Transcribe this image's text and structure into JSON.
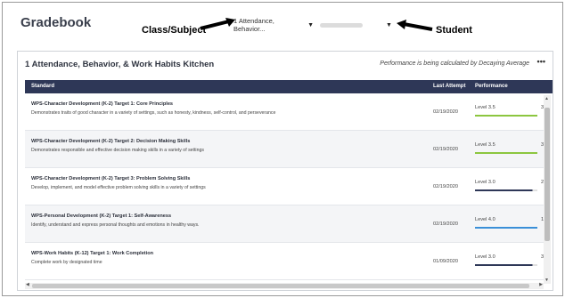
{
  "page": {
    "title": "Gradebook"
  },
  "annotations": {
    "class_subject": "Class/Subject",
    "student": "Student"
  },
  "selectors": {
    "class_value": "1 Attendance, Behavior...",
    "student_value": ""
  },
  "card": {
    "title": "1 Attendance, Behavior, & Work Habits Kitchen",
    "note": "Performance is being calculated by Decaying Average",
    "more": "•••"
  },
  "table": {
    "columns": [
      "Standard",
      "Last Attempt",
      "Performance"
    ],
    "rows": [
      {
        "title": "WPS-Character Development (K-2) Target 1: Core Principles",
        "description": "Demonstrates traits of good character in a variety of settings, such as honesty, kindness, self-control, and perseverance",
        "date": "02/19/2020",
        "level": "Level 3.5",
        "bar_value": "3",
        "bar_fraction": 1.0,
        "bar_color": "#8cc63f"
      },
      {
        "title": "WPS-Character Development (K-2) Target 2: Decision Making Skills",
        "description": "Demonstrates responsible and effective decision making skills in a variety of settings",
        "date": "02/19/2020",
        "level": "Level 3.5",
        "bar_value": "3",
        "bar_fraction": 1.0,
        "bar_color": "#8cc63f"
      },
      {
        "title": "WPS-Character Development (K-2) Target 3: Problem Solving Skills",
        "description": "Develop, implement, and model effective problem solving skills in a variety of settings",
        "date": "02/19/2020",
        "level": "Level 3.0",
        "bar_value": "2",
        "bar_fraction": 0.92,
        "bar_color": "#2e3757"
      },
      {
        "title": "WPS-Personal Development (K-2) Target 1: Self-Awareness",
        "description": "Identify, understand and express personal thoughts and emotions in healthy ways.",
        "date": "02/19/2020",
        "level": "Level 4.0",
        "bar_value": "1",
        "bar_fraction": 1.0,
        "bar_color": "#3a8fd8"
      },
      {
        "title": "WPS-Work Habits (K-12) Target 1: Work Completion",
        "description": "Complete work by designated time",
        "date": "01/09/2020",
        "level": "Level 3.0",
        "bar_value": "3",
        "bar_fraction": 0.92,
        "bar_color": "#2e3757"
      }
    ]
  }
}
